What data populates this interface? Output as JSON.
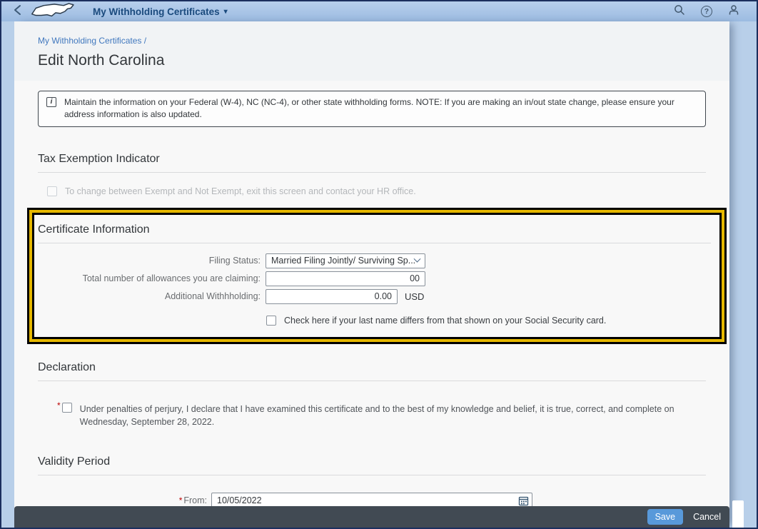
{
  "header": {
    "title": "My Withholding Certificates",
    "caret": "▾"
  },
  "icons": {
    "back": "chevron-left",
    "logo": "north-carolina-state-shape",
    "search": "magnifying-glass",
    "help": "question-mark-circle",
    "profile": "person-silhouette",
    "info": "i",
    "select_caret": "chevron-down",
    "calendar": "calendar-grid"
  },
  "breadcrumb": {
    "text": "My Withholding Certificates /"
  },
  "page": {
    "title": "Edit North Carolina"
  },
  "info_banner": {
    "icon_glyph": "i",
    "text": "Maintain the information on your Federal (W-4), NC (NC-4), or other state withholding forms. NOTE: If you are making an in/out state change, please ensure your address information is also updated."
  },
  "tax_exemption": {
    "title": "Tax Exemption Indicator",
    "checkbox_label": "To change between Exempt and Not Exempt, exit this screen and contact your HR office.",
    "checkbox_checked": false,
    "checkbox_disabled": true
  },
  "certificate_information": {
    "title": "Certificate Information",
    "filing_status": {
      "label": "Filing Status:",
      "value": "Married Filing Jointly/ Surviving Sp..."
    },
    "allowances": {
      "label": "Total number of allowances you are claiming:",
      "value": "00"
    },
    "additional_withholding": {
      "label": "Additional Withhholding:",
      "value": "0.00",
      "currency": "USD"
    },
    "last_name_checkbox": {
      "label": "Check here if your last name differs from that shown on your Social Security card.",
      "checked": false
    }
  },
  "declaration": {
    "title": "Declaration",
    "required_marker": "*",
    "checkbox_label": "Under penalties of perjury, I declare that I have examined this certificate and to the best of my knowledge and belief, it is true, correct, and complete on Wednesday, September 28, 2022.",
    "checked": false
  },
  "validity_period": {
    "title": "Validity Period",
    "required_marker": "*",
    "from_label": "From:",
    "from_value": "10/05/2022"
  },
  "footer": {
    "save_label": "Save",
    "cancel_label": "Cancel"
  },
  "colors": {
    "header_bg": "#a9c6e8",
    "header_title": "#1a4a7d",
    "page_bg": "#b8cfe9",
    "card_bg": "#f8f8f8",
    "link": "#4178be",
    "heading_text": "#32363a",
    "label_text": "#6a6d70",
    "disabled_text": "#b4b7ba",
    "input_border": "#89919a",
    "highlight_yellow": "#e6b800",
    "highlight_black": "#000000",
    "footer_bg": "#414a53",
    "save_button_bg": "#5899da",
    "required_red": "#bb0000",
    "frame_border": "#1b2f5e"
  }
}
